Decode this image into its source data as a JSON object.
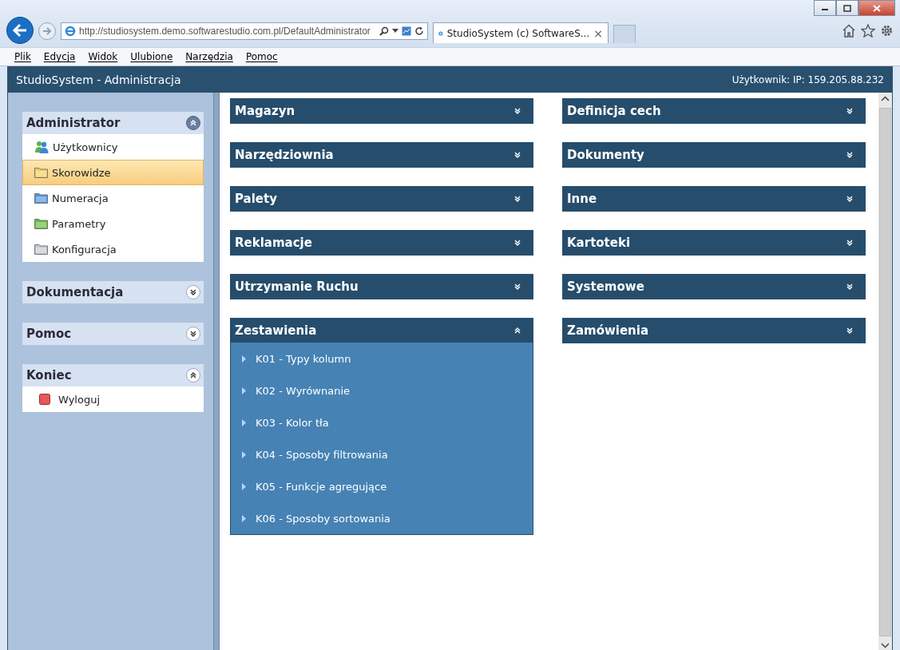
{
  "browser": {
    "address": "http://studiosystem.demo.softwarestudio.com.pl/DefaultAdministrator",
    "tab_title": "StudioSystem (c) SoftwareS...",
    "tab_close": "×"
  },
  "menu": [
    {
      "label": "Plik"
    },
    {
      "label": "Edycja"
    },
    {
      "label": "Widok"
    },
    {
      "label": "Ulubione"
    },
    {
      "label": "Narzędzia"
    },
    {
      "label": "Pomoc"
    }
  ],
  "app": {
    "title": "StudioSystem - Administracja",
    "user_info": "Użytkownik: IP: 159.205.88.232"
  },
  "sidebar": [
    {
      "title": "Administrator",
      "expanded": true,
      "items": [
        {
          "label": "Użytkownicy",
          "kind": "users",
          "selected": false
        },
        {
          "label": "Skorowidze",
          "kind": "folder",
          "color": "#f3cd5c",
          "selected": true
        },
        {
          "label": "Numeracja",
          "kind": "folder",
          "color": "#4f93dd",
          "selected": false
        },
        {
          "label": "Parametry",
          "kind": "folder",
          "color": "#62bb3c",
          "selected": false
        },
        {
          "label": "Konfiguracja",
          "kind": "folder",
          "color": "#c4c8cc",
          "selected": false
        }
      ]
    },
    {
      "title": "Dokumentacja",
      "expanded": false
    },
    {
      "title": "Pomoc",
      "expanded": false
    },
    {
      "title": "Koniec",
      "expanded": true,
      "items": [
        {
          "label": "Wyloguj",
          "kind": "logout",
          "selected": false
        }
      ]
    }
  ],
  "columns": [
    [
      {
        "title": "Magazyn",
        "expanded": false
      },
      {
        "title": "Narzędziownia",
        "expanded": false
      },
      {
        "title": "Palety",
        "expanded": false
      },
      {
        "title": "Reklamacje",
        "expanded": false
      },
      {
        "title": "Utrzymanie Ruchu",
        "expanded": false
      },
      {
        "title": "Zestawienia",
        "expanded": true,
        "items": [
          "K01 - Typy kolumn",
          "K02 - Wyrównanie",
          "K03 - Kolor tła",
          "K04 - Sposoby filtrowania",
          "K05 - Funkcje agregujące",
          "K06 - Sposoby sortowania"
        ]
      }
    ],
    [
      {
        "title": "Definicja cech",
        "expanded": false
      },
      {
        "title": "Dokumenty",
        "expanded": false
      },
      {
        "title": "Inne",
        "expanded": false
      },
      {
        "title": "Kartoteki",
        "expanded": false
      },
      {
        "title": "Systemowe",
        "expanded": false
      },
      {
        "title": "Zamówienia",
        "expanded": false
      }
    ]
  ]
}
